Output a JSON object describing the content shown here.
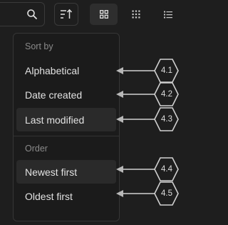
{
  "toolbar": {
    "search_icon": "search-icon",
    "sort_icon": "sort-ascending-icon",
    "views": [
      {
        "name": "grid-large-icon",
        "active": true
      },
      {
        "name": "grid-small-icon",
        "active": false
      },
      {
        "name": "list-icon",
        "active": false
      }
    ]
  },
  "menu": {
    "sort_by_label": "Sort by",
    "sort_items": [
      {
        "label": "Alphabetical",
        "highlighted": false
      },
      {
        "label": "Date created",
        "highlighted": false
      },
      {
        "label": "Last modified",
        "highlighted": true
      }
    ],
    "order_label": "Order",
    "order_items": [
      {
        "label": "Newest first",
        "highlighted": true
      },
      {
        "label": "Oldest first",
        "highlighted": false
      }
    ]
  },
  "callouts": [
    "4.1",
    "4.2",
    "4.3",
    "4.4",
    "4.5"
  ],
  "colors": {
    "background": "#1e1e1e",
    "menu_bg": "#1b1b1b",
    "border": "#363636",
    "highlight": "#2a2a2a",
    "arrow": "#b8b8b8"
  }
}
